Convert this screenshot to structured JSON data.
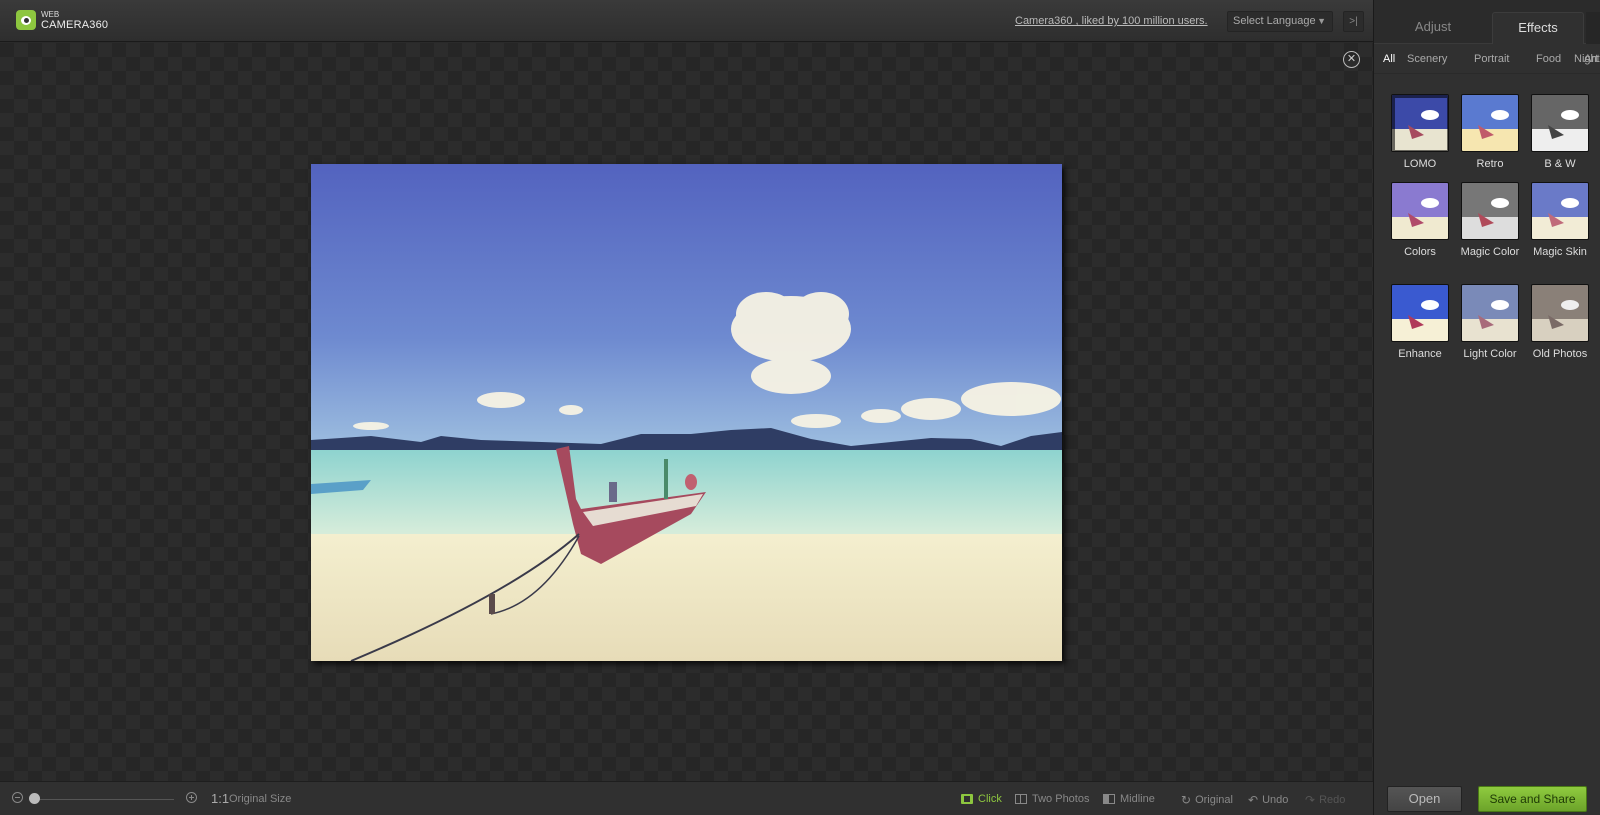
{
  "app": {
    "logo_small": "WEB",
    "logo_big": "CAMERA360",
    "tagline": "Camera360 , liked by 100 million users.",
    "language_select": "Select Language"
  },
  "panel": {
    "tabs": [
      {
        "label": "Adjust",
        "active": false
      },
      {
        "label": "Effects",
        "active": true
      }
    ],
    "categories": [
      {
        "label": "All",
        "active": true
      },
      {
        "label": "Scenery",
        "active": false
      },
      {
        "label": "Portrait",
        "active": false
      },
      {
        "label": "Food",
        "active": false
      },
      {
        "label": "Night",
        "active": false
      },
      {
        "label": "Art",
        "active": false
      }
    ],
    "effects": [
      {
        "label": "LOMO"
      },
      {
        "label": "Retro"
      },
      {
        "label": "B & W"
      },
      {
        "label": "Colors"
      },
      {
        "label": "Magic Color"
      },
      {
        "label": "Magic Skin"
      },
      {
        "label": "Enhance"
      },
      {
        "label": "Light Color"
      },
      {
        "label": "Old Photos"
      }
    ],
    "open_label": "Open",
    "save_label": "Save and Share"
  },
  "bottombar": {
    "ratio": "1:1",
    "original_size": "Original Size",
    "click": "Click",
    "two_photos": "Two Photos",
    "midline": "Midline",
    "original": "Original",
    "undo": "Undo",
    "redo": "Redo",
    "zoom_level": 0.0
  },
  "colors": {
    "accent": "#8dc63f",
    "sky": "#5a6fc0",
    "sea": "#b7ddd8",
    "sand": "#f0ecd0",
    "boat": "#b04a5a"
  }
}
